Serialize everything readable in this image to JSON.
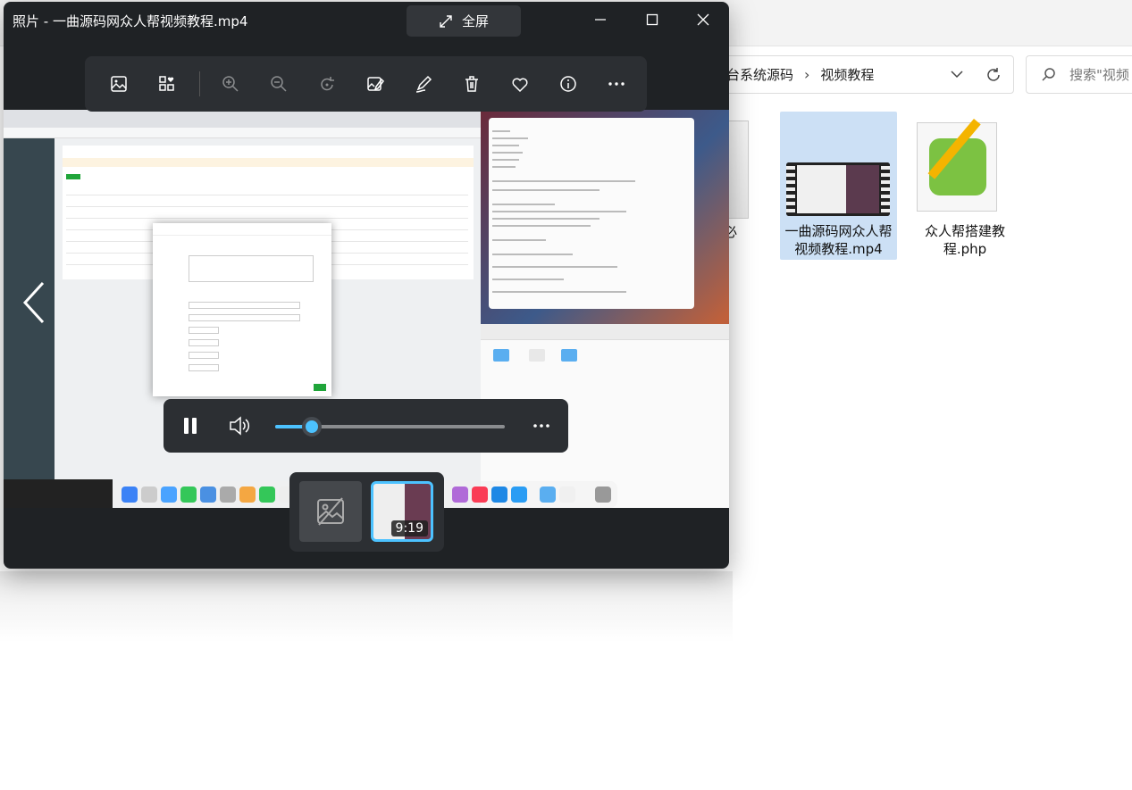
{
  "window": {
    "title": "照片 - 一曲源码网众人帮视频教程.mp4",
    "fullscreen_label": "全屏"
  },
  "toolbar": {
    "buttons": [
      "crop-image",
      "add-collection",
      "zoom-in",
      "zoom-out",
      "rotate",
      "edit-image",
      "draw",
      "delete",
      "favorite",
      "info",
      "more"
    ]
  },
  "player": {
    "progress_fraction": 0.16
  },
  "filmstrip": {
    "duration": "9:19"
  },
  "explorer": {
    "address": {
      "segment1": "台系统源码",
      "separator": "›",
      "segment2": "视频教程"
    },
    "search_placeholder": "搜索\"视频",
    "files": {
      "partial_label": "免明必",
      "mp4_label": "一曲源码网众人帮视频教程.mp4",
      "php_label": "众人帮搭建教程.php"
    }
  },
  "colors": {
    "accent": "#4cc2ff",
    "window_bg": "#1f2225",
    "panel_bg": "#2c2f33",
    "selection_bg": "#cce0f5"
  }
}
